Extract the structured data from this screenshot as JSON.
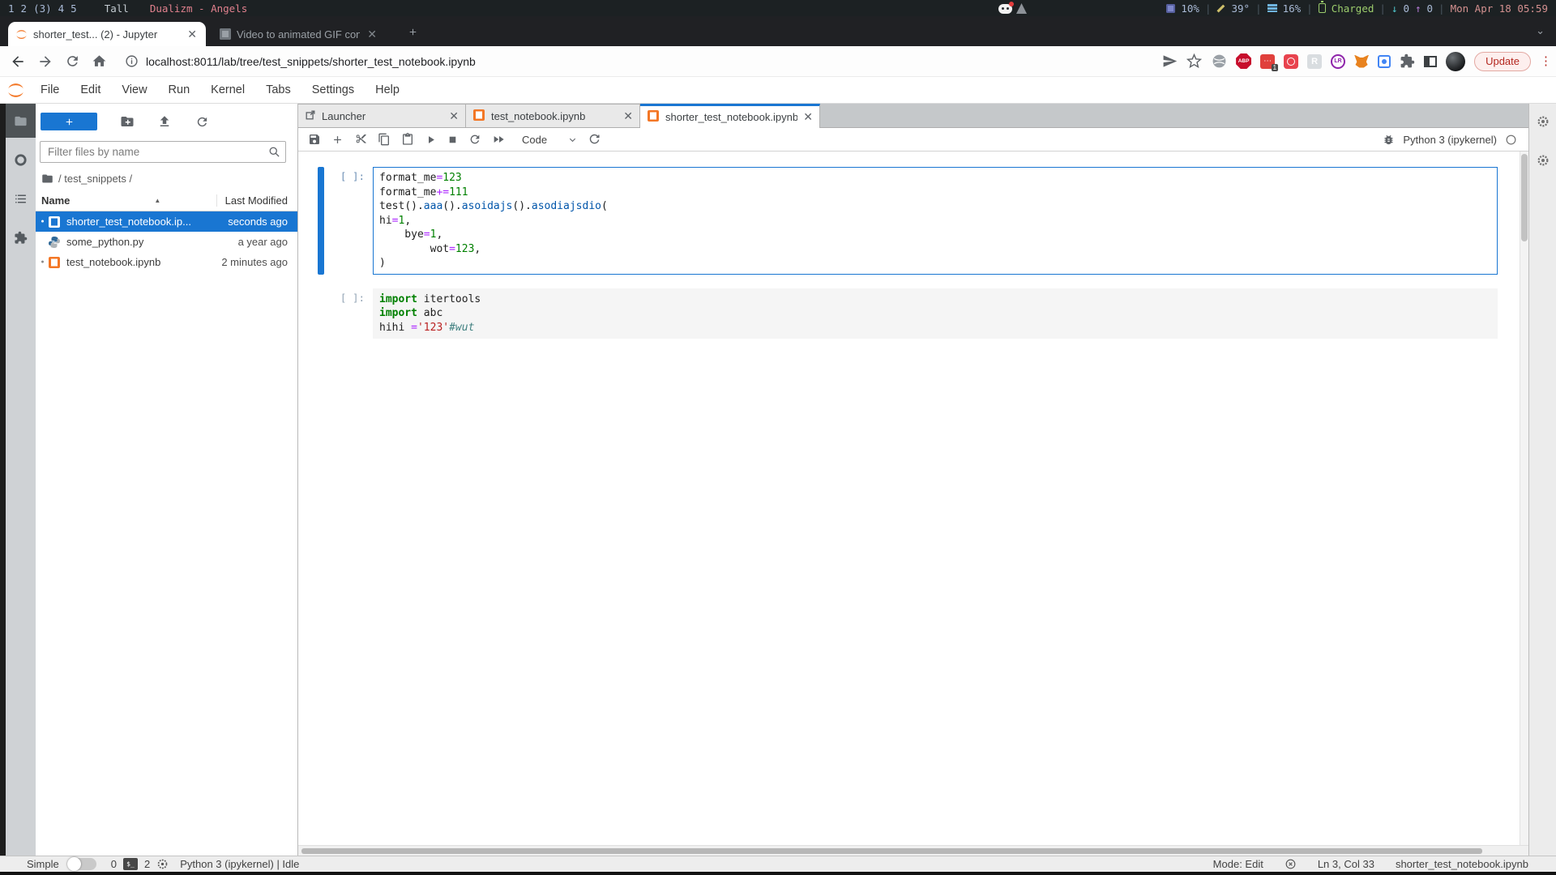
{
  "system_bar": {
    "workspaces": [
      "1",
      "2",
      "(3)",
      "4",
      "5"
    ],
    "active_workspace": "(3)",
    "layout": "Tall",
    "window_title": "Dualizm - Angels",
    "separator": "|",
    "tray": {
      "cpu": "10%",
      "temp": "39°",
      "mem": "16%",
      "battery": "Charged",
      "net_down": "0",
      "net_up": "0",
      "clock": "Mon Apr 18 05:59"
    }
  },
  "browser": {
    "tabs": [
      {
        "title": "shorter_test... (2) - Jupyter",
        "active": true
      },
      {
        "title": "Video to animated GIF con",
        "active": false
      }
    ],
    "url": "localhost:8011/lab/tree/test_snippets/shorter_test_notebook.ipynb",
    "update_label": "Update",
    "ext": {
      "abp_label": "ABP",
      "blocker_dots": "⋯",
      "blocker_badge": "1",
      "r_label": "R",
      "lr_label": "LR"
    }
  },
  "jupyter": {
    "menu": [
      "File",
      "Edit",
      "View",
      "Run",
      "Kernel",
      "Tabs",
      "Settings",
      "Help"
    ],
    "filebrowser": {
      "filter_placeholder": "Filter files by name",
      "breadcrumb": "/ test_snippets /",
      "columns": [
        "Name",
        "Last Modified"
      ],
      "files": [
        {
          "name": "shorter_test_notebook.ip...",
          "modified": "seconds ago",
          "icon": "notebook",
          "selected": true,
          "dirty": true
        },
        {
          "name": "some_python.py",
          "modified": "a year ago",
          "icon": "python",
          "selected": false,
          "dirty": false
        },
        {
          "name": "test_notebook.ipynb",
          "modified": "2 minutes ago",
          "icon": "notebook",
          "selected": false,
          "dirty": true
        }
      ]
    },
    "dock_tabs": [
      {
        "label": "Launcher",
        "icon": "launcher",
        "active": false
      },
      {
        "label": "test_notebook.ipynb",
        "icon": "notebook",
        "active": false
      },
      {
        "label": "shorter_test_notebook.ipynb",
        "icon": "notebook",
        "active": true
      }
    ],
    "toolbar": {
      "cell_type": "Code",
      "kernel_name": "Python 3 (ipykernel)"
    },
    "cells": [
      {
        "prompt": "[ ]:",
        "active": true,
        "lines": [
          [
            {
              "t": "format_me"
            },
            {
              "t": "=",
              "s": "op"
            },
            {
              "t": "123",
              "s": "num"
            }
          ],
          [
            {
              "t": "format_me"
            },
            {
              "t": "+=",
              "s": "op"
            },
            {
              "t": "111",
              "s": "num"
            }
          ],
          [
            {
              "t": "test"
            },
            {
              "t": "()."
            },
            {
              "t": "aaa",
              "s": "prop"
            },
            {
              "t": "()."
            },
            {
              "t": "asoidajs",
              "s": "prop"
            },
            {
              "t": "()."
            },
            {
              "t": "asodiajsdio",
              "s": "prop"
            },
            {
              "t": "("
            }
          ],
          [
            {
              "t": "hi"
            },
            {
              "t": "=",
              "s": "op"
            },
            {
              "t": "1",
              "s": "num"
            },
            {
              "t": ","
            }
          ],
          [
            {
              "t": "    bye"
            },
            {
              "t": "=",
              "s": "op"
            },
            {
              "t": "1",
              "s": "num"
            },
            {
              "t": ","
            }
          ],
          [
            {
              "t": "        wot"
            },
            {
              "t": "=",
              "s": "op"
            },
            {
              "t": "123",
              "s": "num"
            },
            {
              "t": ","
            }
          ],
          [
            {
              "t": ")"
            }
          ]
        ]
      },
      {
        "prompt": "[ ]:",
        "active": false,
        "lines": [
          [
            {
              "t": "import",
              "s": "kw"
            },
            {
              "t": " itertools"
            }
          ],
          [
            {
              "t": "import",
              "s": "kw"
            },
            {
              "t": " abc"
            }
          ],
          [
            {
              "t": "hihi "
            },
            {
              "t": "=",
              "s": "op"
            },
            {
              "t": "'123'",
              "s": "str"
            },
            {
              "t": "#wut",
              "s": "com"
            }
          ]
        ]
      }
    ],
    "statusbar": {
      "simple_label": "Simple",
      "terminals": "0",
      "kernels": "2",
      "kernel_status": "Python 3 (ipykernel) | Idle",
      "mode": "Mode: Edit",
      "position": "Ln 3, Col 33",
      "filename": "shorter_test_notebook.ipynb"
    }
  }
}
